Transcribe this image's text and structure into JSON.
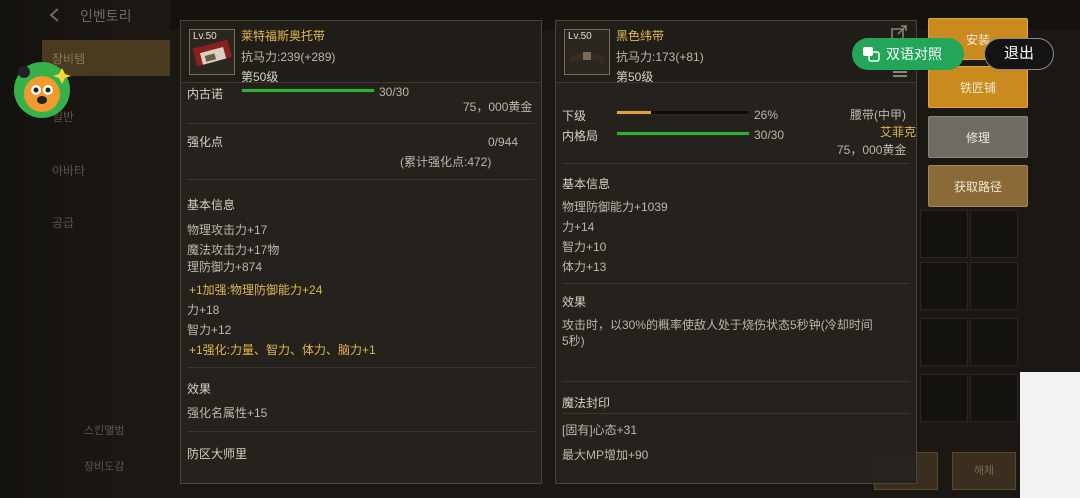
{
  "background": {
    "inventory_title": "인벤토리",
    "left_tabs": [
      "장비템",
      "일반",
      "아바타",
      "공급"
    ],
    "left_footer": [
      "스킨앨범",
      "장비도감"
    ],
    "bottom_buttons": [
      "해체",
      "해체"
    ]
  },
  "item1": {
    "level_badge": "Lv.50",
    "name": "莱特福斯奥托带",
    "resistance": "抗马力:239(+289)",
    "grade": "第50级",
    "durability_label": "内古诺",
    "durability_value": "30/30",
    "durability_fraction": 1.0,
    "price": "75，000黄金",
    "enhance_label": "强化点",
    "enhance_value": "0/944",
    "enhance_total": "(累计强化点:472)",
    "basic_info_title": "基本信息",
    "basic_lines": [
      "物理攻击力+17",
      "魔法攻击力+17物",
      "理防御力+874"
    ],
    "bonus_line_1": "+1加强:物理防御能力+24",
    "basic_lines_2": [
      "力+18",
      "智力+12"
    ],
    "bonus_line_2": "+1强化:力量、智力、体力、脑力+1",
    "effect_title": "效果",
    "effect_text": "强化名属性+15",
    "set_title": "防区大师里"
  },
  "item2": {
    "level_badge": "Lv.50",
    "name": "黑色纬带",
    "resistance": "抗马力:173(+81)",
    "grade": "第50级",
    "rank_label": "下级",
    "rank_percent": "26%",
    "rank_fraction": 0.26,
    "durability_label": "内格局",
    "durability_value": "30/30",
    "durability_fraction": 1.0,
    "slot_type": "腰带(中甲)",
    "maker": "艾菲克",
    "price": "75，000黄金",
    "basic_info_title": "基本信息",
    "basic_lines": [
      "物理防御能力+1039",
      "力+14",
      "智力+10",
      "体力+13"
    ],
    "effect_title": "效果",
    "effect_text_1": "攻击时，以30%的概率使敌人处于烧伤状态5秒钟(冷却时间",
    "effect_text_2": "5秒)",
    "seal_title": "魔法封印",
    "seal_lines": [
      "[固有]心态+31",
      "最大MP增加+90"
    ]
  },
  "actions": {
    "install": "安装",
    "blacksmith": "铁匠铺",
    "repair": "修理",
    "obtain": "获取路径"
  },
  "overlay": {
    "bilingual": "双语对照",
    "exit": "退出"
  },
  "colors": {
    "accent_gold": "#e0b651",
    "bar_green": "#2fb12f",
    "bar_orange": "#e0a230",
    "button_orange": "#c98a1e",
    "pill_green": "#23a55a"
  }
}
